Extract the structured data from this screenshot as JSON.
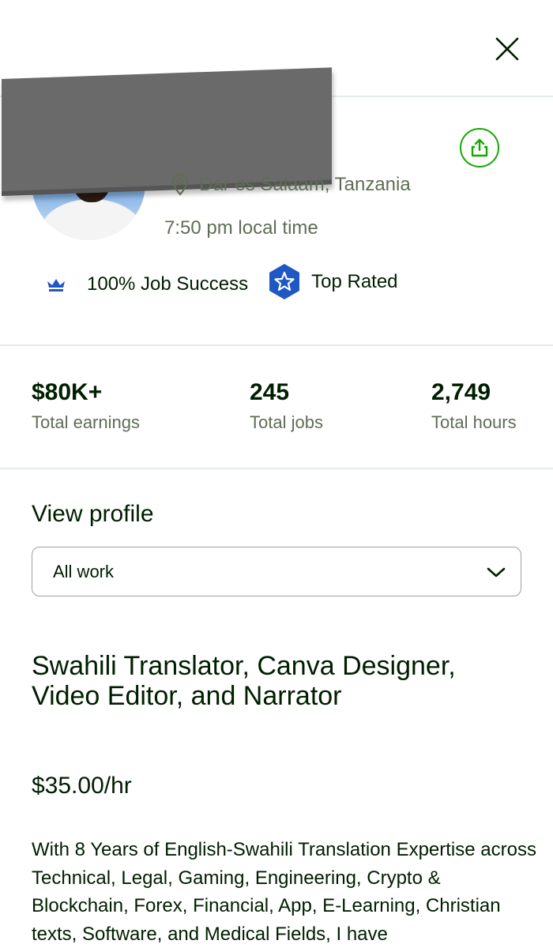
{
  "profile": {
    "location": "Dar es Salaam, Tanzania",
    "local_time": "7:50 pm local time",
    "job_success": "100% Job Success",
    "top_rated": "Top Rated"
  },
  "stats": [
    {
      "value": "$80K+",
      "label": "Total earnings"
    },
    {
      "value": "245",
      "label": "Total jobs"
    },
    {
      "value": "2,749",
      "label": "Total hours"
    }
  ],
  "view_profile": {
    "title": "View profile",
    "selected": "All work"
  },
  "listing": {
    "title": "Swahili Translator, Canva Designer, Video Editor, and Narrator",
    "rate": "$35.00/hr",
    "description": "With 8 Years of English-Swahili Translation Expertise across Technical, Legal, Gaming, Engineering, Crypto & Blockchain, Forex, Financial, App, E-Learning, Christian texts, Software, and Medical Fields, I have"
  },
  "colors": {
    "accent_green": "#14a800",
    "badge_blue": "#1f57c3",
    "text_primary": "#001e00",
    "text_secondary": "#5e6d55"
  },
  "icons": {
    "close": "close-icon",
    "share": "share-icon",
    "location": "map-pin-icon",
    "job_success": "crown-icon",
    "top_rated": "star-badge-icon",
    "dropdown": "chevron-down-icon"
  }
}
